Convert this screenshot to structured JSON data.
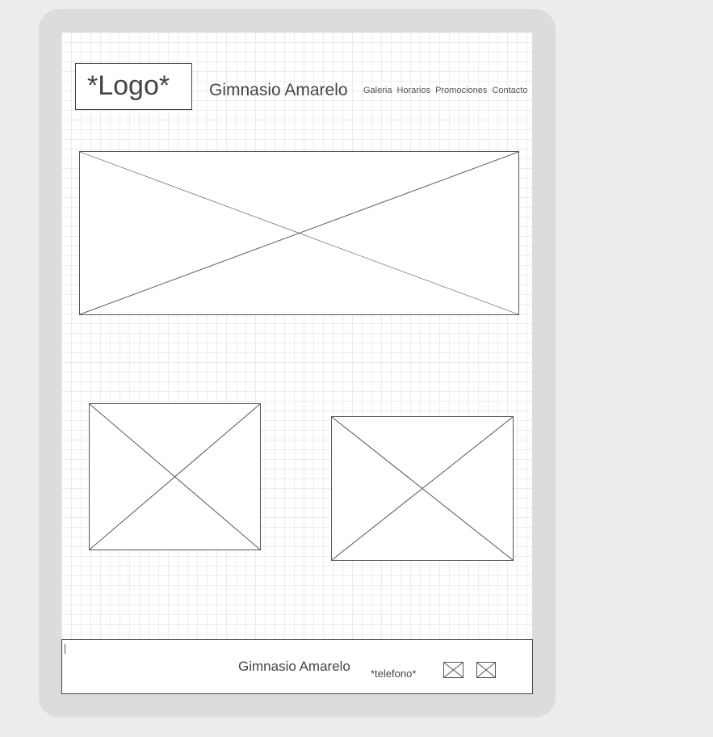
{
  "header": {
    "logo": "*Logo*",
    "title": "Gimnasio Amarelo",
    "nav": [
      "Galeria",
      "Horarios",
      "Promociones",
      "Contacto"
    ]
  },
  "footer": {
    "title": "Gimnasio Amarelo",
    "phone": "*telefono*"
  }
}
